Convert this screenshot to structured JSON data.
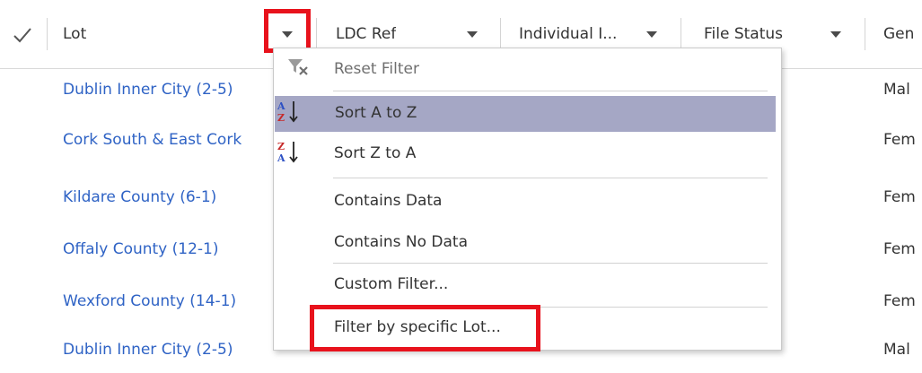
{
  "header": {
    "columns": [
      {
        "label": "Lot"
      },
      {
        "label": "LDC Ref"
      },
      {
        "label": "Individual I..."
      },
      {
        "label": "File Status"
      },
      {
        "label": "Gen"
      }
    ]
  },
  "rows": [
    {
      "lot": "Dublin Inner City (2-5)",
      "gender": "Mal"
    },
    {
      "lot": "Cork South & East Cork",
      "gender": "Fem"
    },
    {
      "lot": "Kildare County (6-1)",
      "gender": "Fem"
    },
    {
      "lot": "Offaly County (12-1)",
      "gender": "Fem"
    },
    {
      "lot": "Wexford County (14-1)",
      "gender": "Fem"
    },
    {
      "lot": "Dublin Inner City (2-5)",
      "gender": "Mal"
    }
  ],
  "menu": {
    "reset_filter": "Reset Filter",
    "sort_az": "Sort A to Z",
    "sort_za": "Sort Z to A",
    "contains_data": "Contains Data",
    "contains_no_data": "Contains No Data",
    "custom_filter": "Custom Filter...",
    "filter_specific": "Filter by specific Lot..."
  },
  "colors": {
    "link": "#2f63c5",
    "highlight_box": "#e8121c",
    "menu_active": "#a5a7c5"
  },
  "icons": [
    "check-icon",
    "dropdown-caret-icon",
    "clear-filter-icon",
    "sort-ascending-icon",
    "sort-descending-icon"
  ]
}
